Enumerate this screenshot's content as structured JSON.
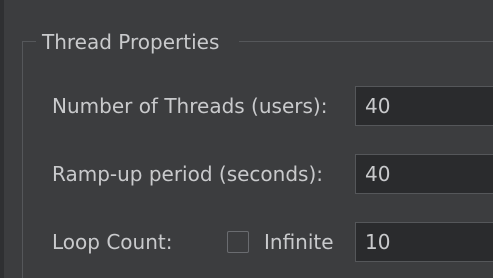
{
  "group": {
    "title": "Thread Properties"
  },
  "fields": {
    "threads": {
      "label": "Number of Threads (users):",
      "value": "40"
    },
    "rampup": {
      "label": "Ramp-up period (seconds):",
      "value": "40"
    },
    "loop": {
      "label": "Loop Count:",
      "infinite_label": "Infinite",
      "infinite_checked": false,
      "value": "10"
    }
  },
  "colors": {
    "background": "#3c3d3f",
    "text": "#c9cacc",
    "input_background": "#2a2b2d",
    "border": "#55575a"
  }
}
